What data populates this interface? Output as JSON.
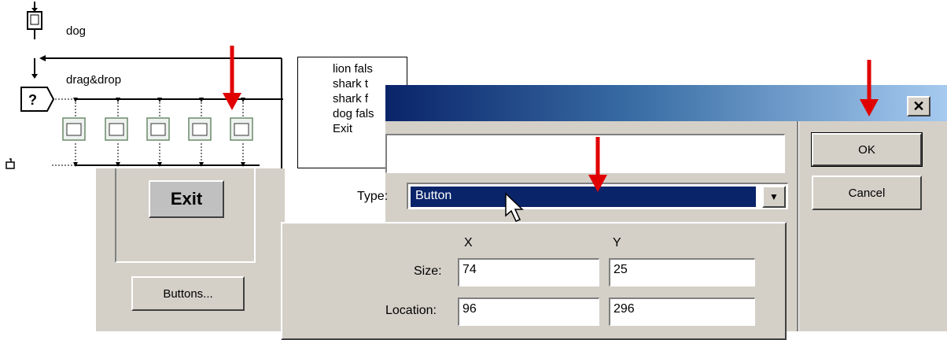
{
  "flowline": {
    "top_icon_label": "dog",
    "interaction_label": "drag&drop",
    "exit_list": [
      "lion fals",
      "shark t",
      "shark f",
      "dog fals",
      "Exit"
    ]
  },
  "left_dialog": {
    "preview_button_label": "Exit",
    "buttons_button_label": "Buttons..."
  },
  "properties_dialog": {
    "close_glyph": "✕",
    "ok_label": "OK",
    "cancel_label": "Cancel",
    "name_value": "",
    "type_label": "Type:",
    "type_value": "Button",
    "type_arrow_glyph": "▼",
    "col_x": "X",
    "col_y": "Y",
    "size_label": "Size:",
    "size_x": "74",
    "size_y": "25",
    "location_label": "Location:",
    "location_x": "96",
    "location_y": "296"
  },
  "annotation": {
    "arrow_color": "#e00000",
    "arrow_count": 4
  }
}
